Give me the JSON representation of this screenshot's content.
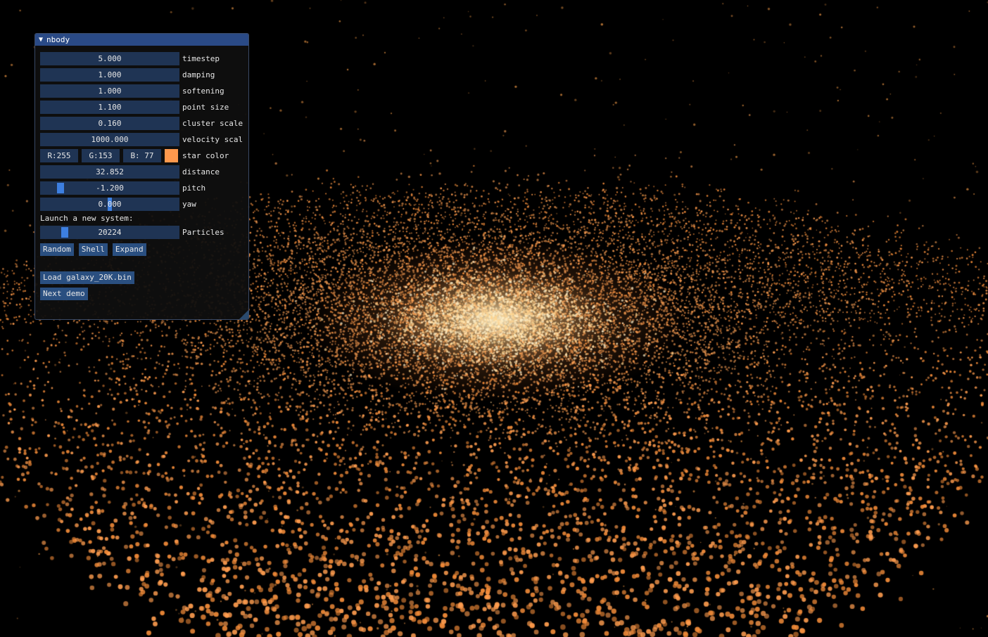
{
  "window": {
    "title": "nbody",
    "collapse_glyph": "▼"
  },
  "params": {
    "timestep": {
      "value": "5.000",
      "label": "timestep"
    },
    "damping": {
      "value": "1.000",
      "label": "damping"
    },
    "softening": {
      "value": "1.000",
      "label": "softening"
    },
    "point_size": {
      "value": "1.100",
      "label": "point size"
    },
    "cluster_scale": {
      "value": "0.160",
      "label": "cluster scale"
    },
    "velocity_scale": {
      "value": "1000.000",
      "label": "velocity scal"
    },
    "distance": {
      "value": "32.852",
      "label": "distance"
    },
    "pitch": {
      "value": "-1.200",
      "label": "pitch",
      "slider_fraction": 0.13
    },
    "yaw": {
      "value_pre": "0.",
      "value_sel": "0",
      "value_post": "00",
      "label": "yaw"
    }
  },
  "star_color": {
    "r": "R:255",
    "g": "G:153",
    "b": "B: 77",
    "label": "star color",
    "hex": "#ff994d"
  },
  "launch": {
    "heading": "Launch a new system:",
    "particles_value": "20224",
    "particles_label": "Particles",
    "particles_slider_fraction": 0.16,
    "buttons": {
      "random": "Random",
      "shell": "Shell",
      "expand": "Expand"
    }
  },
  "actions": {
    "load": "Load galaxy_20K.bin",
    "next_demo": "Next demo"
  },
  "colors": {
    "background": "#000000",
    "title_bar": "#2a4a86",
    "field": "#1f3454",
    "button": "#2a4f80",
    "slider_grab": "#3d7fe0",
    "star": "#ff994d"
  }
}
